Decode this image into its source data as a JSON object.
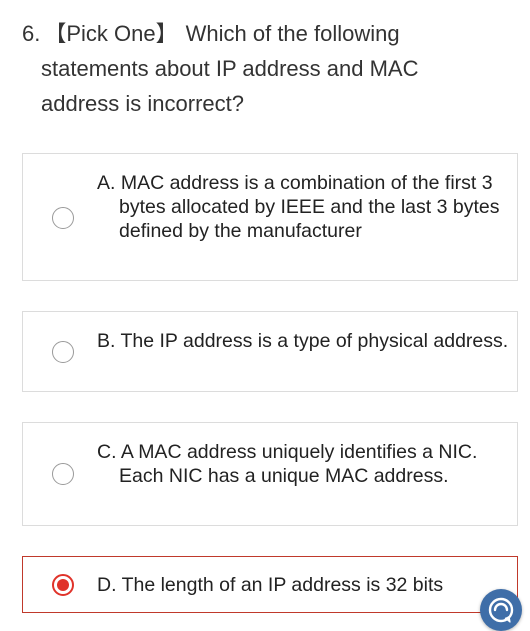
{
  "question": {
    "number": "6.",
    "type": "【Pick One】",
    "line1": "Which of the following",
    "rest": "statements about IP address and MAC address is incorrect?"
  },
  "options": [
    {
      "text": "A. MAC address is a combination of the first 3 bytes allocated by IEEE and the last 3 bytes defined by the manufacturer",
      "selected": false
    },
    {
      "text": "B. The IP address is a type of physical address.",
      "selected": false
    },
    {
      "text": "C. A MAC address uniquely identifies a NIC. Each NIC has a unique MAC address.",
      "selected": false
    },
    {
      "text": "D. The length of an IP address is 32 bits",
      "selected": true
    }
  ],
  "colors": {
    "selected_border": "#c0392b",
    "radio_selected": "#e0332a",
    "fab_background": "#3f6ea8"
  },
  "icons": {
    "fab": "chat-support-icon"
  }
}
